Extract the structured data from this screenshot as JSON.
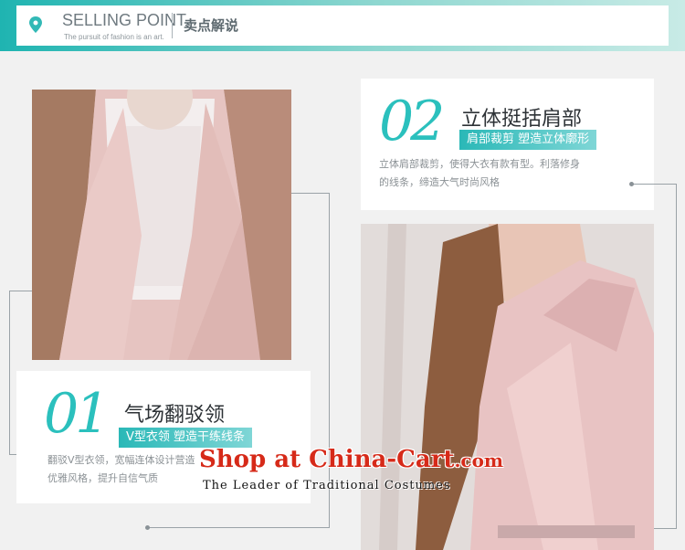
{
  "header": {
    "title": "SELLING POINT",
    "subtitle": "The pursuit of fashion is an art.",
    "title_cn": "卖点解说",
    "icon": "location-pin-icon"
  },
  "feature_02": {
    "number": "02",
    "title": "立体挺括肩部",
    "tagline": "肩部裁剪 塑造立体廓形",
    "desc_line1": "立体肩部裁剪，使得大衣有款有型。利落修身",
    "desc_line2": "的线条，缔造大气时尚风格"
  },
  "feature_01": {
    "number": "01",
    "title": "气场翻驳领",
    "tagline": "V型衣领 塑造干练线条",
    "desc_line1": "翻驳V型衣领，宽幅连体设计营造",
    "desc_line2": "优雅风格，提升自信气质"
  },
  "watermark": {
    "line1_main": "Shop at China-Cart",
    "line1_suffix": ".com",
    "line2": "The Leader of Traditional Costumes"
  },
  "colors": {
    "accent": "#2bc0bd",
    "watermark_red": "#d62a19"
  }
}
